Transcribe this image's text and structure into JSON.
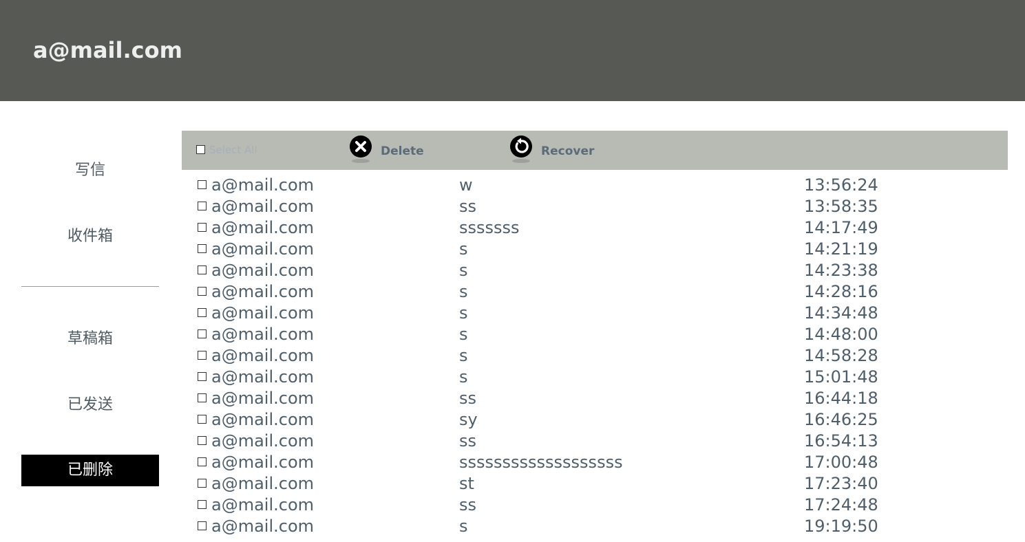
{
  "header": {
    "title": "a@mail.com"
  },
  "sidebar": {
    "items": [
      {
        "label": "写信",
        "active": false
      },
      {
        "label": "收件箱",
        "active": false
      },
      {
        "label": "草稿箱",
        "active": false
      },
      {
        "label": "已发送",
        "active": false
      },
      {
        "label": "已删除",
        "active": true
      }
    ]
  },
  "toolbar": {
    "select_all_label": "Select All",
    "delete_label": "Delete",
    "recover_label": "Recover"
  },
  "mails": [
    {
      "from": "a@mail.com",
      "subject": "w",
      "time": "13:56:24"
    },
    {
      "from": "a@mail.com",
      "subject": "ss",
      "time": "13:58:35"
    },
    {
      "from": "a@mail.com",
      "subject": "sssssss",
      "time": "14:17:49"
    },
    {
      "from": "a@mail.com",
      "subject": "s",
      "time": "14:21:19"
    },
    {
      "from": "a@mail.com",
      "subject": "s",
      "time": "14:23:38"
    },
    {
      "from": "a@mail.com",
      "subject": "s",
      "time": "14:28:16"
    },
    {
      "from": "a@mail.com",
      "subject": "s",
      "time": "14:34:48"
    },
    {
      "from": "a@mail.com",
      "subject": "s",
      "time": "14:48:00"
    },
    {
      "from": "a@mail.com",
      "subject": "s",
      "time": "14:58:28"
    },
    {
      "from": "a@mail.com",
      "subject": "s",
      "time": "15:01:48"
    },
    {
      "from": "a@mail.com",
      "subject": "ss",
      "time": "16:44:18"
    },
    {
      "from": "a@mail.com",
      "subject": "sy",
      "time": "16:46:25"
    },
    {
      "from": "a@mail.com",
      "subject": "ss",
      "time": "16:54:13"
    },
    {
      "from": "a@mail.com",
      "subject": "sssssssssssssssssss",
      "time": "17:00:48"
    },
    {
      "from": "a@mail.com",
      "subject": "st",
      "time": "17:23:40"
    },
    {
      "from": "a@mail.com",
      "subject": "ss",
      "time": "17:24:48"
    },
    {
      "from": "a@mail.com",
      "subject": "s",
      "time": "19:19:50"
    }
  ]
}
